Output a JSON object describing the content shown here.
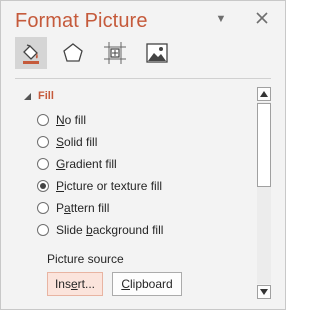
{
  "pane": {
    "title": "Format Picture",
    "options_glyph": "▼",
    "close_icon": "close-icon"
  },
  "tabs": [
    {
      "icon": "fill-line-icon",
      "active": true
    },
    {
      "icon": "effects-pentagon-icon",
      "active": false
    },
    {
      "icon": "size-properties-icon",
      "active": false
    },
    {
      "icon": "picture-icon",
      "active": false
    }
  ],
  "fill_section": {
    "title": "Fill",
    "expanded": true,
    "options": [
      {
        "pre": "",
        "key": "N",
        "post": "o fill",
        "checked": false
      },
      {
        "pre": "",
        "key": "S",
        "post": "olid fill",
        "checked": false
      },
      {
        "pre": "",
        "key": "G",
        "post": "radient fill",
        "checked": false
      },
      {
        "pre": "",
        "key": "P",
        "post": "icture or texture fill",
        "checked": true
      },
      {
        "pre": "P",
        "key": "a",
        "post": "ttern fill",
        "checked": false
      },
      {
        "pre": "Slide ",
        "key": "b",
        "post": "ackground fill",
        "checked": false
      }
    ],
    "picture_source_label": "Picture source",
    "insert_button": {
      "pre": "Ins",
      "key": "e",
      "post": "rt..."
    },
    "clipboard_button": {
      "pre": "",
      "key": "C",
      "post": "lipboard"
    }
  },
  "colors": {
    "accent": "#c55a3b",
    "pane_bg": "#f3f3f3",
    "hover_button": "#fbe4dc"
  }
}
